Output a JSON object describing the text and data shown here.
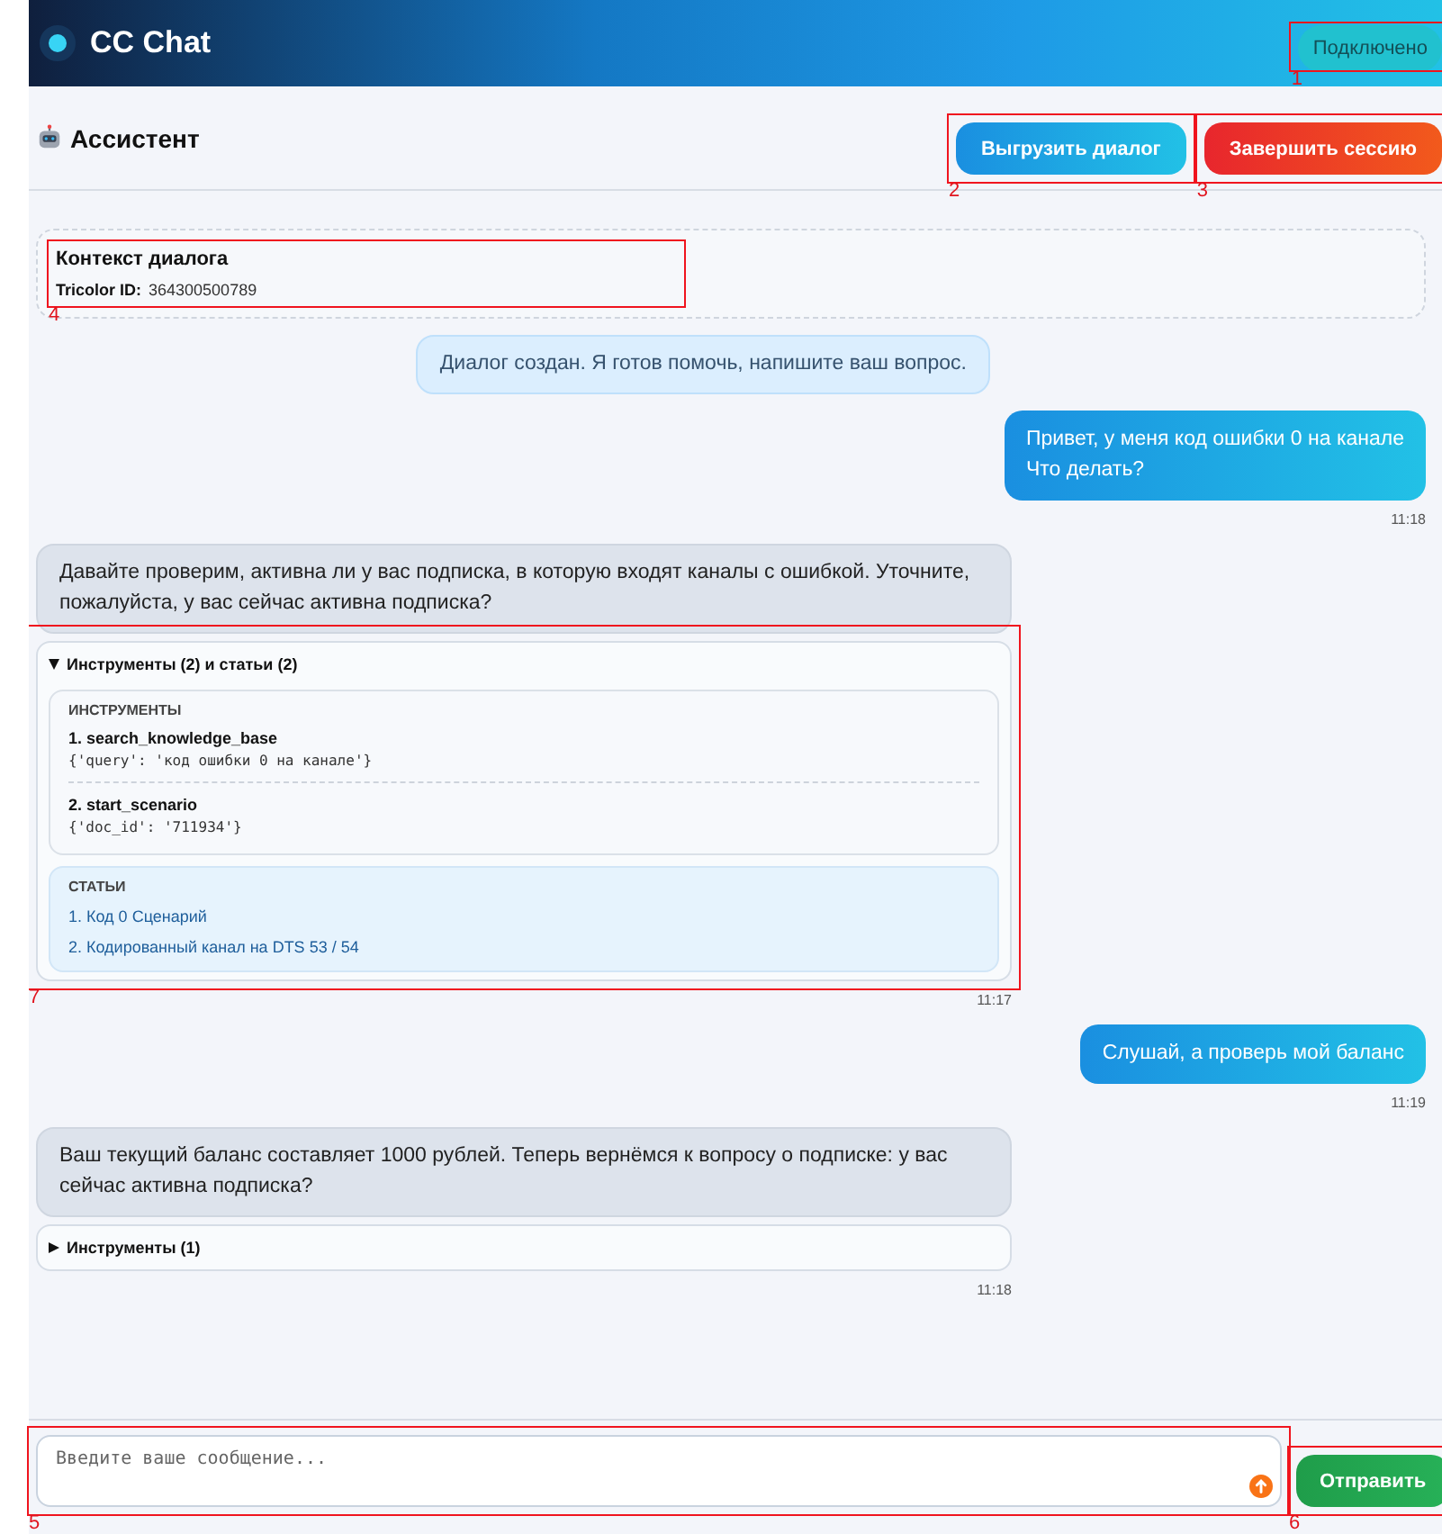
{
  "app": {
    "title": "CC Chat",
    "status": {
      "text": "Подключено",
      "connected": true,
      "marker": "1"
    }
  },
  "assistant_bar": {
    "title": "Ассистент",
    "buttons": [
      {
        "label": "Выгрузить диалог",
        "kind": "export",
        "marker": "2"
      },
      {
        "label": "Завершить сессию",
        "kind": "end",
        "marker": "3"
      }
    ]
  },
  "context": {
    "title": "Контекст диалога",
    "fields": [
      {
        "label": "Tricolor ID:",
        "value": "364300500789"
      }
    ],
    "marker": "4"
  },
  "messages": [
    {
      "kind": "system",
      "text": "Диалог создан. Я готов помочь, напишите ваш вопрос."
    },
    {
      "kind": "user",
      "text": "Привет, у меня код ошибки 0 на канале\nЧто делать?",
      "time": "11:18"
    },
    {
      "kind": "assistant",
      "text": "Давайте проверим, активна ли у вас подписка, в которую входят каналы с ошибкой. Уточните, пожалуйста, у вас сейчас активна подписка?",
      "details": {
        "summary": "Инструменты (2) и статьи (2)",
        "expanded": true,
        "marker": "7",
        "tools": {
          "heading": "ИНСТРУМЕНТЫ",
          "items": [
            {
              "name": "1. search_knowledge_base",
              "args": "{'query': 'код ошибки 0 на канале'}"
            },
            {
              "name": "2. start_scenario",
              "args": "{'doc_id': '711934'}"
            }
          ]
        },
        "articles": {
          "heading": "СТАТЬИ",
          "items": [
            "1. Код 0 Сценарий",
            "2. Кодированный канал на DTS 53 / 54"
          ]
        }
      },
      "time": "11:17"
    },
    {
      "kind": "user",
      "text": "Слушай, а проверь мой баланс",
      "time": "11:19"
    },
    {
      "kind": "assistant",
      "text": "Ваш текущий баланс составляет 1000 рублей. Теперь вернёмся к вопросу о подписке: у вас сейчас активна подписка?",
      "details": {
        "summary": "Инструменты (1)",
        "expanded": false
      },
      "time": "11:18"
    }
  ],
  "composer": {
    "placeholder": "Введите ваше сообщение...",
    "marker": "5",
    "send": {
      "label": "Отправить",
      "marker": "6"
    }
  }
}
